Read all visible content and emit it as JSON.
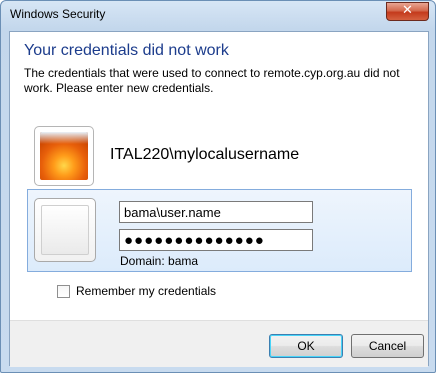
{
  "window": {
    "title": "Windows Security",
    "close_glyph": "✕"
  },
  "dialog": {
    "heading": "Your credentials did not work",
    "description": "The credentials that were used to connect to remote.cyp.org.au did not work. Please enter new credentials."
  },
  "saved_user": {
    "name": "ITAL220\\mylocalusername",
    "icon": "flower-avatar-icon"
  },
  "credential_entry": {
    "username_value": "bama\\user.name",
    "password_mask": "●●●●●●●●●●●●●●",
    "domain_label": "Domain:",
    "domain_value": "bama",
    "icon": "blank-avatar-icon"
  },
  "remember": {
    "label": "Remember my credentials",
    "checked": false
  },
  "buttons": {
    "ok": "OK",
    "cancel": "Cancel"
  },
  "colors": {
    "heading": "#1c3c8c",
    "panel_border": "#84acdd",
    "close_button": "#c43a1c"
  }
}
